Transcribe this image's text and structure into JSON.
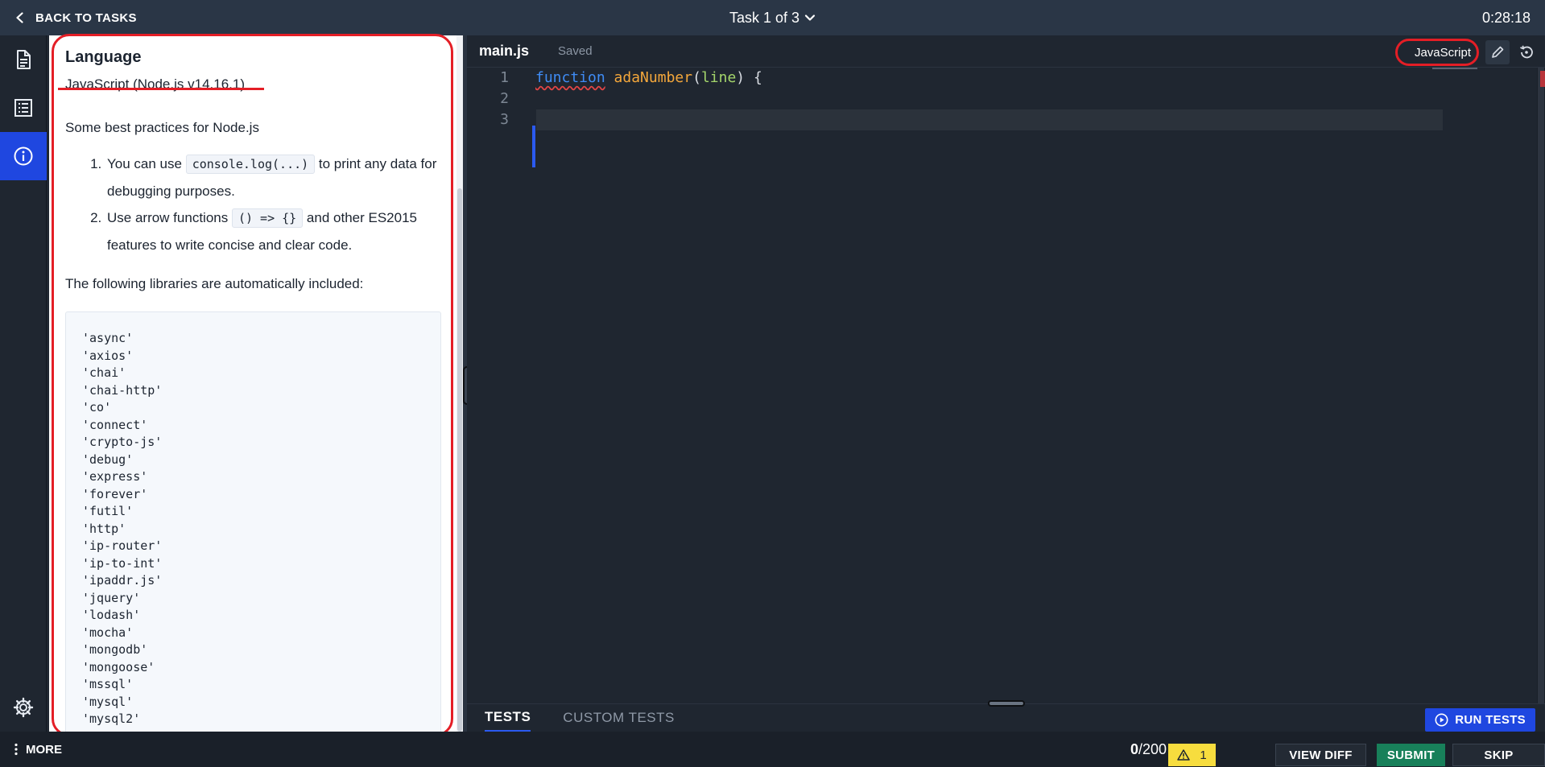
{
  "topbar": {
    "back_label": "BACK TO TASKS",
    "task_title": "Task 1 of 3",
    "timer": "0:28:18"
  },
  "description": {
    "heading": "Language",
    "language_name": "JavaScript (Node.js v14.16.1)",
    "best_practices_intro": "Some best practices for Node.js",
    "tips": [
      {
        "before": "You can use ",
        "code": "console.log(...)",
        "after": " to print any data for debugging purposes."
      },
      {
        "before": "Use arrow functions ",
        "code": "() => {}",
        "after": " and other ES2015 features to write concise and clear code."
      }
    ],
    "libraries_intro": "The following libraries are automatically included:",
    "libraries": [
      "'async'",
      "'axios'",
      "'chai'",
      "'chai-http'",
      "'co'",
      "'connect'",
      "'crypto-js'",
      "'debug'",
      "'express'",
      "'forever'",
      "'futil'",
      "'http'",
      "'ip-router'",
      "'ip-to-int'",
      "'ipaddr.js'",
      "'jquery'",
      "'lodash'",
      "'mocha'",
      "'mongodb'",
      "'mongoose'",
      "'mssql'",
      "'mysql'",
      "'mysql2'"
    ]
  },
  "editor": {
    "filename": "main.js",
    "status": "Saved",
    "language": "JavaScript",
    "line_numbers": [
      "1",
      "2",
      "3"
    ],
    "code": {
      "keyword": "function",
      "name": "adaNumber",
      "open": "(",
      "param": "line",
      "close": ") {"
    }
  },
  "tests": {
    "tab_tests": "TESTS",
    "tab_custom": "CUSTOM TESTS",
    "run_label": "RUN TESTS"
  },
  "footer": {
    "more_label": "MORE",
    "score_current": "0",
    "score_total": "/200",
    "warning_count": "1",
    "view_diff_label": "VIEW DIFF",
    "submit_label": "SUBMIT",
    "skip_label": "SKIP"
  },
  "colors": {
    "accent": "#1f47e0",
    "submit": "#18805a",
    "warning": "#f7dd3e",
    "annotation": "#e41e26"
  }
}
